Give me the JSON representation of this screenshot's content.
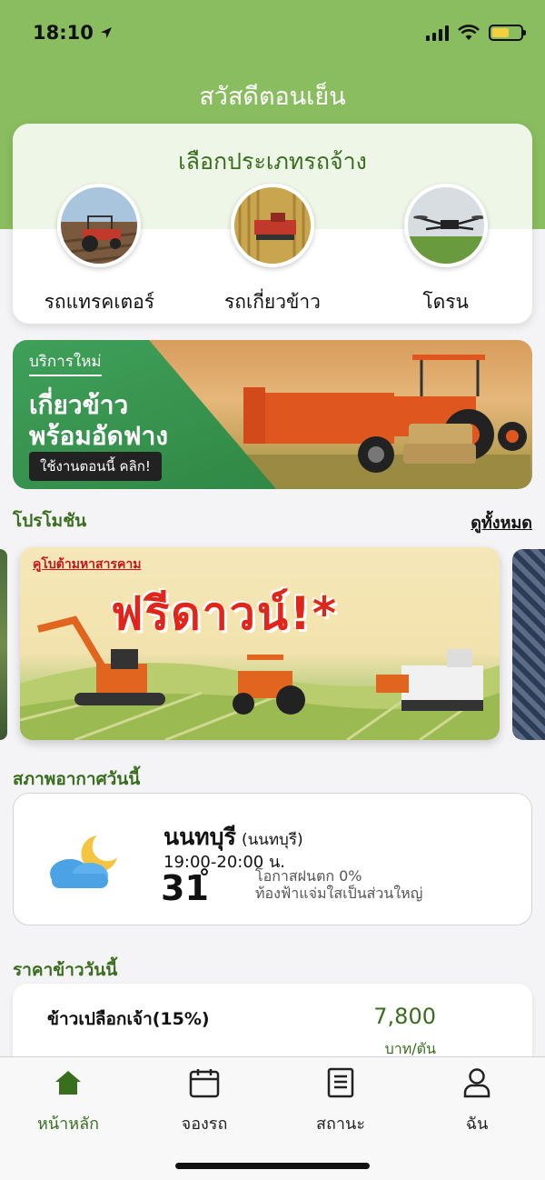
{
  "status_bar": {
    "time": "18:10"
  },
  "header": {
    "greeting": "สวัสดีตอนเย็น"
  },
  "vehicle_types": {
    "title": "เลือกประเภทรถจ้าง",
    "items": [
      {
        "label": "รถแทรคเตอร์",
        "icon": "tractor-icon"
      },
      {
        "label": "รถเกี่ยวข้าว",
        "icon": "harvester-icon"
      },
      {
        "label": "โดรน",
        "icon": "drone-icon"
      }
    ]
  },
  "new_service_banner": {
    "badge": "บริการใหม่",
    "line1": "เกี่ยวข้าว",
    "line2": "พร้อมอัดฟาง",
    "cta": "ใช้งานตอนนี้ คลิก!"
  },
  "promotions": {
    "title": "โปรโมชัน",
    "see_all": "ดูทั้งหมด",
    "card": {
      "kicker": "คูโบต้ามหาสารคาม",
      "headline": "ฟรีดาวน์!*"
    }
  },
  "weather": {
    "title": "สภาพอากาศวันนี้",
    "city": "นนทบุรี",
    "province": "(นนทบุรี)",
    "time_range": "19:00-20:00 น.",
    "temperature": "31",
    "degree_symbol": "°",
    "rain_chance": "โอกาสฝนตก 0%",
    "description": "ท้องฟ้าแจ่มใสเป็นส่วนใหญ่"
  },
  "rice_price": {
    "title": "ราคาข้าววันนี้",
    "items": [
      {
        "name": "ข้าวเปลือกเจ้า(15%)",
        "price": "7,800",
        "unit": "บาท/ตัน"
      }
    ]
  },
  "tab_bar": {
    "tabs": [
      {
        "label": "หน้าหลัก",
        "icon": "home-icon",
        "active": true
      },
      {
        "label": "จองรถ",
        "icon": "calendar-icon",
        "active": false
      },
      {
        "label": "สถานะ",
        "icon": "document-icon",
        "active": false
      },
      {
        "label": "ฉัน",
        "icon": "user-icon",
        "active": false
      }
    ]
  },
  "colors": {
    "primary": "#8abd5f",
    "accent_dark": "#3a6e1f",
    "promo_red": "#e0251b"
  }
}
